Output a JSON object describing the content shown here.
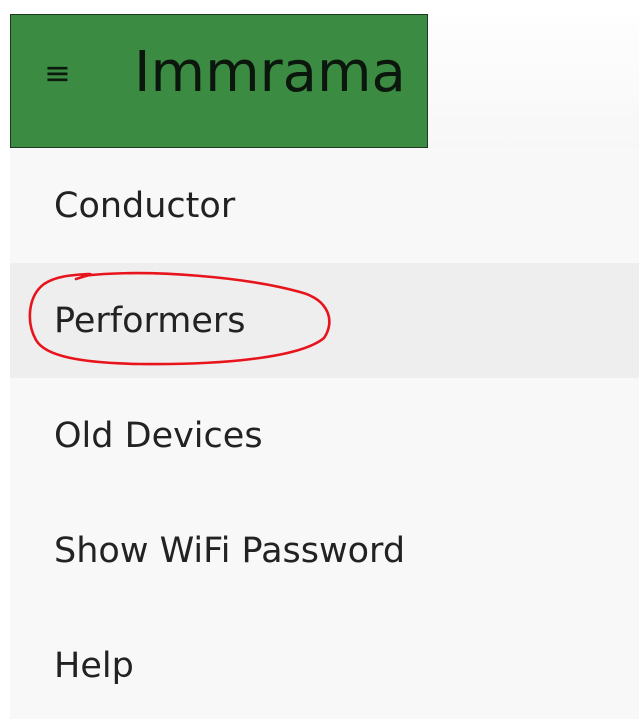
{
  "app": {
    "title": "Immrama",
    "menu_icon": "hamburger-icon",
    "header_color": "#3b8b43"
  },
  "menu": {
    "items": [
      {
        "label": "Conductor",
        "selected": false
      },
      {
        "label": "Performers",
        "selected": true
      },
      {
        "label": "Old Devices",
        "selected": false
      },
      {
        "label": "Show WiFi Password",
        "selected": false
      },
      {
        "label": "Help",
        "selected": false
      }
    ]
  },
  "annotation": {
    "shape": "ellipse",
    "color": "#e8141c",
    "target": "Performers"
  }
}
